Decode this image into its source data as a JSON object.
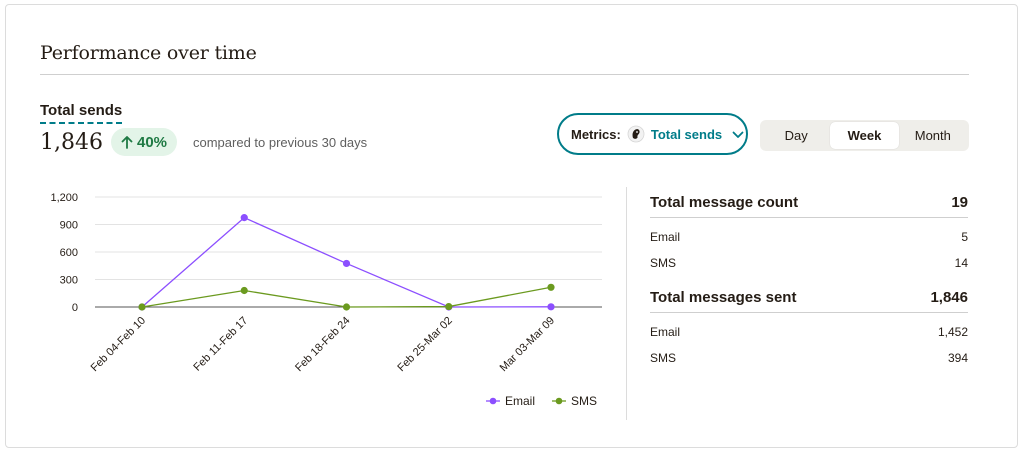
{
  "section": {
    "title": "Performance over time"
  },
  "metric": {
    "label": "Total sends",
    "value": "1,846",
    "delta": "40%",
    "delta_direction": "up",
    "compare_text": "compared to previous 30 days"
  },
  "metrics_selector": {
    "label": "Metrics:",
    "value": "Total sends"
  },
  "period_toggle": {
    "options": [
      "Day",
      "Week",
      "Month"
    ],
    "selected": "Week"
  },
  "chart_data": {
    "type": "line",
    "categories": [
      "Feb 04-Feb 10",
      "Feb 11-Feb 17",
      "Feb 18-Feb 24",
      "Feb 25-Mar 02",
      "Mar 03-Mar 09"
    ],
    "series": [
      {
        "name": "Email",
        "color": "#8c4fff",
        "values": [
          0,
          975,
          475,
          0,
          2
        ]
      },
      {
        "name": "SMS",
        "color": "#6b9a1f",
        "values": [
          0,
          180,
          0,
          5,
          215
        ]
      }
    ],
    "yticks": [
      "1,200",
      "900",
      "600",
      "300",
      "0"
    ],
    "ytick_values": [
      1200,
      900,
      600,
      300,
      0
    ],
    "ylim": [
      0,
      1200
    ],
    "grid": true,
    "legend_position": "bottom-right"
  },
  "stats": {
    "count_title": "Total message count",
    "count_total": "19",
    "count_rows": [
      {
        "label": "Email",
        "value": "5"
      },
      {
        "label": "SMS",
        "value": "14"
      }
    ],
    "sent_title": "Total messages sent",
    "sent_total": "1,846",
    "sent_rows": [
      {
        "label": "Email",
        "value": "1,452"
      },
      {
        "label": "SMS",
        "value": "394"
      }
    ]
  },
  "colors": {
    "accent": "#007c89",
    "positive_bg": "#e3f4e8",
    "positive_text": "#1f7a44"
  },
  "icons": {
    "delta": "arrow-up-icon",
    "selector_logo": "mailchimp-freddie-icon",
    "selector_chevron": "chevron-down-icon"
  }
}
